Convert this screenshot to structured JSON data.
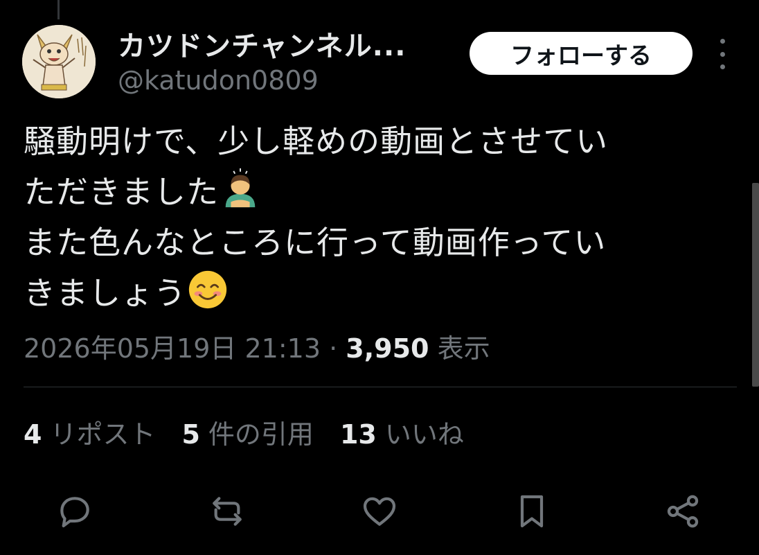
{
  "author": {
    "display_name": "カツドンチャンネル...",
    "handle": "@katudon0809"
  },
  "follow_button": "フォローする",
  "tweet": {
    "lines": [
      "騒動明けで、少し軽めの動画とさせてい",
      "ただきました",
      "また色んなところに行って動画作ってい",
      "きましょう"
    ],
    "emojis": [
      "man-bowing-emoji",
      "smiling-face-emoji"
    ]
  },
  "meta": {
    "datetime": "2026年05月19日 21:13",
    "separator": "·",
    "views_count": "3,950",
    "views_label": "表示"
  },
  "stats": {
    "reposts_count": "4",
    "reposts_label": "リポスト",
    "quotes_count": "5",
    "quotes_label": "件の引用",
    "likes_count": "13",
    "likes_label": "いいね"
  },
  "actions": [
    "reply-icon",
    "repost-icon",
    "like-icon",
    "bookmark-icon",
    "share-icon"
  ],
  "colors": {
    "background": "#000000",
    "primary_text": "#e7e9ea",
    "secondary_text": "#71767b",
    "divider": "#2f3336",
    "follow_button_bg": "#ffffff"
  }
}
